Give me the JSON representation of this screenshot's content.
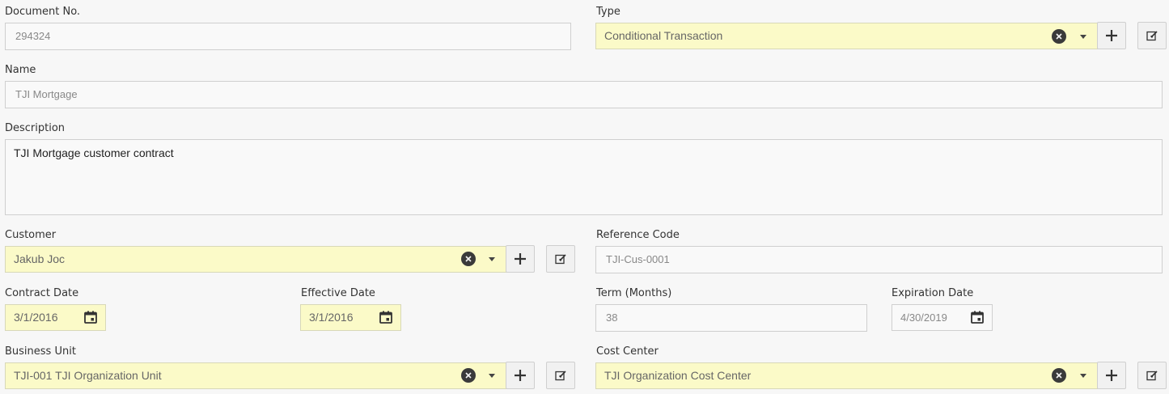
{
  "document_no": {
    "label": "Document No.",
    "value": "294324"
  },
  "type": {
    "label": "Type",
    "value": "Conditional Transaction"
  },
  "name": {
    "label": "Name",
    "value": "TJI Mortgage"
  },
  "description": {
    "label": "Description",
    "value": "TJI Mortgage customer contract"
  },
  "customer": {
    "label": "Customer",
    "value": "Jakub Joc"
  },
  "reference_code": {
    "label": "Reference Code",
    "value": "TJI-Cus-0001"
  },
  "contract_date": {
    "label": "Contract Date",
    "value": "3/1/2016"
  },
  "effective_date": {
    "label": "Effective Date",
    "value": "3/1/2016"
  },
  "term": {
    "label": "Term (Months)",
    "value": "38"
  },
  "expiration_date": {
    "label": "Expiration Date",
    "value": "4/30/2019"
  },
  "business_unit": {
    "label": "Business Unit",
    "value": "TJI-001 TJI Organization Unit"
  },
  "cost_center": {
    "label": "Cost Center",
    "value": "TJI Organization Cost Center"
  },
  "icons": {
    "clear": "clear-icon",
    "dropdown": "chevron-down-icon",
    "add": "plus-icon",
    "edit": "edit-icon",
    "calendar": "calendar-icon"
  },
  "colors": {
    "required_field_bg": "#fbfac8",
    "field_bg": "#f9f9f9",
    "page_bg": "#f7f7f7"
  }
}
